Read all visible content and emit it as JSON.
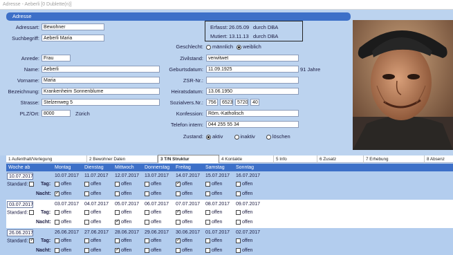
{
  "window": {
    "title": "Adresse - Aeberli [0 Dublette(n)]"
  },
  "section": {
    "title": "Adresse"
  },
  "form": {
    "adressart_label": "Adressart:",
    "adressart": "Bewohner",
    "suchbegriff_label": "Suchbegriff:",
    "suchbegriff": "Aeberli Maria",
    "geschlecht_label": "Geschlecht:",
    "geschlecht_m": "männlich",
    "geschlecht_w": "weiblich",
    "anrede_label": "Anrede:",
    "anrede": "Frau",
    "name_label": "Name:",
    "name": "Aeberli",
    "vorname_label": "Vorname:",
    "vorname": "Maria",
    "bezeichnung_label": "Bezeichnung:",
    "bezeichnung": "Krankenheim Sonnenblume",
    "strasse_label": "Strasse:",
    "strasse": "Stelzenweg 5",
    "plz_label": "PLZ/Ort:",
    "plz": "8000",
    "ort": "Zürich",
    "zivilstand_label": "Zivilstand:",
    "zivilstand": "verwitwet",
    "geburtsdatum_label": "Geburtsdatum:",
    "geburtsdatum": "11.09.1925",
    "alter": "91 Jahre",
    "zsr_label": "ZSR-Nr.:",
    "zsr": "",
    "heiratsdatum_label": "Heiratsdatum:",
    "heiratsdatum": "13.06.1950",
    "sozialvers_label": "Sozialvers.Nr.:",
    "sv1": "756",
    "sv2": "6523",
    "sv3": "5720",
    "sv4": "40",
    "konfession_label": "Konfession:",
    "konfession": "Röm.-Katholisch",
    "telefon_label": "Telefon intern:",
    "telefon": "044 255 55 34",
    "zustand_label": "Zustand:",
    "zustand_aktiv": "aktiv",
    "zustand_inaktiv": "inaktiv",
    "zustand_loeschen": "löschen"
  },
  "info": {
    "erfasst_label": "Erfasst:",
    "erfasst_date": "26.05.09",
    "erfasst_by": "durch DBA",
    "mutiert_label": "Mutiert:",
    "mutiert_date": "13.11.13",
    "mutiert_by": "durch DBA"
  },
  "tabs": [
    "1 Aufenthalt/Verlegung",
    "2 Bewohner Daten",
    "3 T/N Struktur",
    "4 Kontakte",
    "5 Info",
    "6 Zusatz",
    "7 Erhebung",
    "8 Absenz"
  ],
  "grid": {
    "headers": [
      "Woche ab",
      "Montag",
      "Dienstag",
      "Mittwoch",
      "Donnerstag",
      "Freitag",
      "Samstag",
      "Sonntag"
    ],
    "standard_label": "Standard:",
    "tag_label": "Tag:",
    "nacht_label": "Nacht:",
    "offen": "offen",
    "weeks": [
      {
        "start": "10.07.2017",
        "dates": [
          "10.07.2017",
          "11.07.2017",
          "12.07.2017",
          "13.07.2017",
          "14.07.2017",
          "15.07.2017",
          "16.07.2017"
        ]
      },
      {
        "start": "03.07.2017",
        "dates": [
          "03.07.2017",
          "04.07.2017",
          "05.07.2017",
          "06.07.2017",
          "07.07.2017",
          "08.07.2017",
          "09.07.2017"
        ]
      },
      {
        "start": "26.06.2017",
        "dates": [
          "26.06.2017",
          "27.06.2017",
          "28.06.2017",
          "29.06.2017",
          "30.06.2017",
          "01.07.2017",
          "02.07.2017"
        ]
      }
    ]
  },
  "colors": {
    "accent": "#3d70c8",
    "panel": "#bcd3ef",
    "background": "#b3cdee"
  },
  "icons": {
    "photo": "resident-photo"
  }
}
